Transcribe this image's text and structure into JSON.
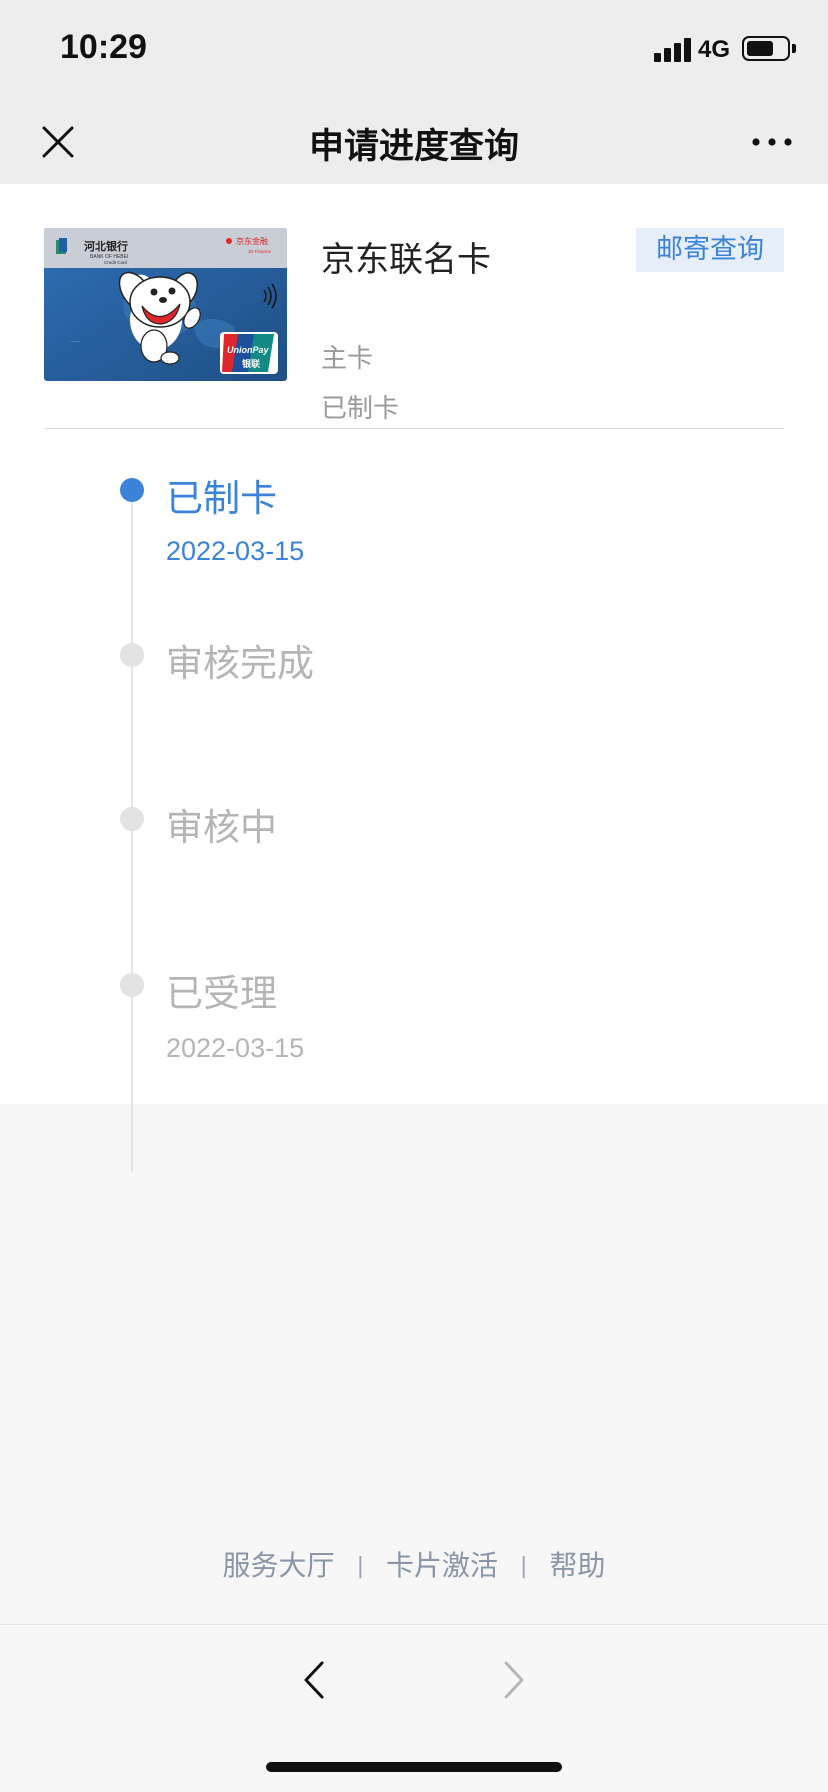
{
  "status_bar": {
    "time": "10:29",
    "network": "4G",
    "icons": [
      "signal-icon",
      "battery-icon"
    ]
  },
  "navbar": {
    "title": "申请进度查询",
    "icons": [
      "close-icon",
      "more-icon"
    ]
  },
  "card": {
    "name": "京东联名卡",
    "type": "主卡",
    "status": "已制卡",
    "mail_button": "邮寄查询",
    "image": {
      "bank_name": "河北银行",
      "bank_name_en": "BANK OF HEBEI",
      "card_label": "Credit Card",
      "partner": "京东金融",
      "partner_en": "JD Finance",
      "unionpay": "UnionPay",
      "unionpay_cn": "银联",
      "colors": {
        "top_band": "#c9ced6",
        "body": "#2d66a8",
        "accent": "#e0262d"
      }
    }
  },
  "timeline": {
    "steps": [
      {
        "title": "已制卡",
        "date": "2022-03-15",
        "state": "active"
      },
      {
        "title": "审核完成",
        "date": "",
        "state": "inactive"
      },
      {
        "title": "审核中",
        "date": "",
        "state": "inactive"
      },
      {
        "title": "已受理",
        "date": "2022-03-15",
        "state": "inactive"
      }
    ]
  },
  "footer": {
    "links": [
      "服务大厅",
      "卡片激活",
      "帮助"
    ],
    "separator": "|"
  },
  "toolbar": {
    "icons": [
      "back-arrow-icon",
      "forward-arrow-icon"
    ]
  },
  "colors": {
    "accent": "#3a83d8",
    "inactive": "#b5b5b5",
    "header_bg": "#ededed",
    "page_bg": "#f7f7f7"
  }
}
